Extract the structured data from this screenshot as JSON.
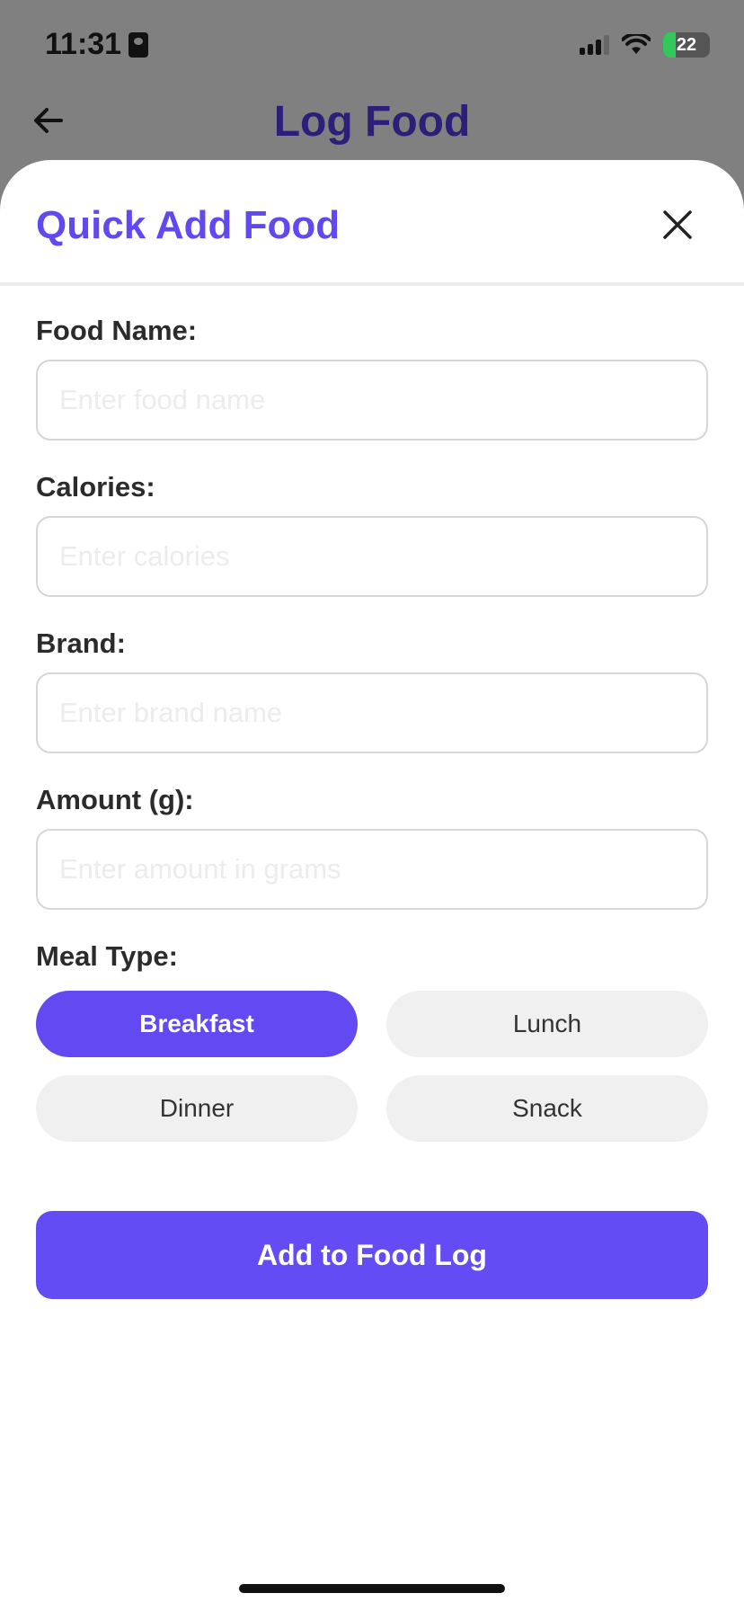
{
  "status_bar": {
    "time": "11:31",
    "battery": "22"
  },
  "header": {
    "title": "Log Food"
  },
  "sheet": {
    "title": "Quick Add Food",
    "fields": [
      {
        "label": "Food Name:",
        "placeholder": "Enter food name",
        "value": ""
      },
      {
        "label": "Calories:",
        "placeholder": "Enter calories",
        "value": ""
      },
      {
        "label": "Brand:",
        "placeholder": "Enter brand name",
        "value": ""
      },
      {
        "label": "Amount (g):",
        "placeholder": "Enter amount in grams",
        "value": ""
      }
    ],
    "meal_type": {
      "label": "Meal Type:",
      "options": [
        "Breakfast",
        "Lunch",
        "Dinner",
        "Snack"
      ],
      "selected": "Breakfast"
    },
    "submit_label": "Add to Food Log"
  },
  "colors": {
    "accent": "#6349f1",
    "header_title": "#2b1f7a",
    "overlay": "#808080"
  }
}
